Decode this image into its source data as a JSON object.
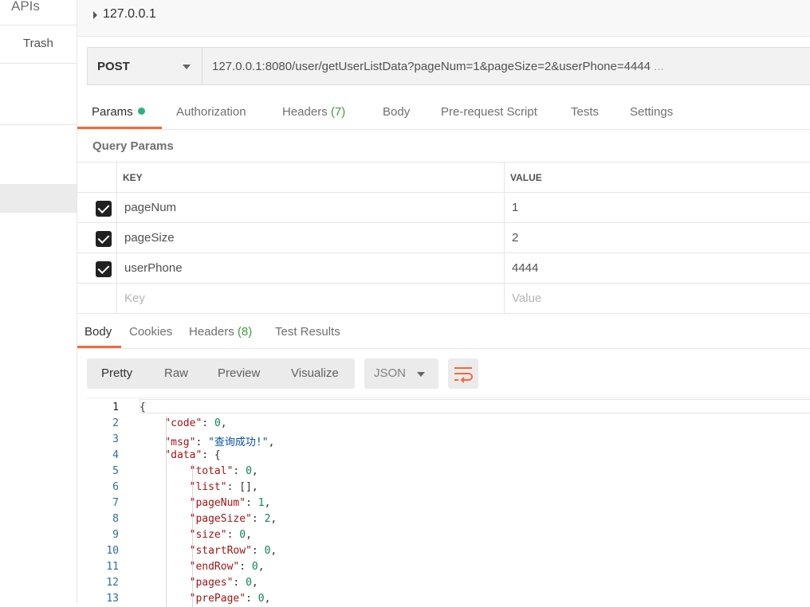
{
  "sidebar": {
    "apis_label": "APIs",
    "trash_label": "Trash"
  },
  "request": {
    "name": "127.0.0.1",
    "method": "POST",
    "url": "127.0.0.1:8080/user/getUserListData?pageNum=1&pageSize=2&userPhone=4444",
    "url_overflow": "..."
  },
  "request_tabs": [
    {
      "label": "Params",
      "count": ""
    },
    {
      "label": "Authorization",
      "count": ""
    },
    {
      "label": "Headers",
      "count": "(7)"
    },
    {
      "label": "Body",
      "count": ""
    },
    {
      "label": "Pre-request Script",
      "count": ""
    },
    {
      "label": "Tests",
      "count": ""
    },
    {
      "label": "Settings",
      "count": ""
    }
  ],
  "query_params": {
    "title": "Query Params",
    "key_header": "KEY",
    "value_header": "VALUE",
    "rows": [
      {
        "key": "pageNum",
        "value": "1",
        "checked": true
      },
      {
        "key": "pageSize",
        "value": "2",
        "checked": true
      },
      {
        "key": "userPhone",
        "value": "4444",
        "checked": true
      }
    ],
    "key_placeholder": "Key",
    "value_placeholder": "Value"
  },
  "response_tabs": [
    {
      "label": "Body",
      "count": ""
    },
    {
      "label": "Cookies",
      "count": ""
    },
    {
      "label": "Headers",
      "count": "(8)"
    },
    {
      "label": "Test Results",
      "count": ""
    }
  ],
  "view_modes": [
    "Pretty",
    "Raw",
    "Preview",
    "Visualize"
  ],
  "format": "JSON",
  "colors": {
    "accent": "#f26b3a",
    "status_green": "#26b47f",
    "count_green": "#3f9b3f"
  },
  "code_lines": [
    {
      "num": "1",
      "parts": [
        [
          "p",
          "{"
        ]
      ]
    },
    {
      "num": "2",
      "parts": [
        [
          "p",
          "    "
        ],
        [
          "k",
          "\"code\""
        ],
        [
          "p",
          ": "
        ],
        [
          "n",
          "0"
        ],
        [
          "p",
          ","
        ]
      ]
    },
    {
      "num": "3",
      "parts": [
        [
          "p",
          "    "
        ],
        [
          "k",
          "\"msg\""
        ],
        [
          "p",
          ": "
        ],
        [
          "s",
          "\"查询成功!\""
        ],
        [
          "p",
          ","
        ]
      ]
    },
    {
      "num": "4",
      "parts": [
        [
          "p",
          "    "
        ],
        [
          "k",
          "\"data\""
        ],
        [
          "p",
          ": {"
        ]
      ]
    },
    {
      "num": "5",
      "parts": [
        [
          "p",
          "        "
        ],
        [
          "k",
          "\"total\""
        ],
        [
          "p",
          ": "
        ],
        [
          "n",
          "0"
        ],
        [
          "p",
          ","
        ]
      ]
    },
    {
      "num": "6",
      "parts": [
        [
          "p",
          "        "
        ],
        [
          "k",
          "\"list\""
        ],
        [
          "p",
          ": [],"
        ]
      ]
    },
    {
      "num": "7",
      "parts": [
        [
          "p",
          "        "
        ],
        [
          "k",
          "\"pageNum\""
        ],
        [
          "p",
          ": "
        ],
        [
          "n",
          "1"
        ],
        [
          "p",
          ","
        ]
      ]
    },
    {
      "num": "8",
      "parts": [
        [
          "p",
          "        "
        ],
        [
          "k",
          "\"pageSize\""
        ],
        [
          "p",
          ": "
        ],
        [
          "n",
          "2"
        ],
        [
          "p",
          ","
        ]
      ]
    },
    {
      "num": "9",
      "parts": [
        [
          "p",
          "        "
        ],
        [
          "k",
          "\"size\""
        ],
        [
          "p",
          ": "
        ],
        [
          "n",
          "0"
        ],
        [
          "p",
          ","
        ]
      ]
    },
    {
      "num": "10",
      "parts": [
        [
          "p",
          "        "
        ],
        [
          "k",
          "\"startRow\""
        ],
        [
          "p",
          ": "
        ],
        [
          "n",
          "0"
        ],
        [
          "p",
          ","
        ]
      ]
    },
    {
      "num": "11",
      "parts": [
        [
          "p",
          "        "
        ],
        [
          "k",
          "\"endRow\""
        ],
        [
          "p",
          ": "
        ],
        [
          "n",
          "0"
        ],
        [
          "p",
          ","
        ]
      ]
    },
    {
      "num": "12",
      "parts": [
        [
          "p",
          "        "
        ],
        [
          "k",
          "\"pages\""
        ],
        [
          "p",
          ": "
        ],
        [
          "n",
          "0"
        ],
        [
          "p",
          ","
        ]
      ]
    },
    {
      "num": "13",
      "parts": [
        [
          "p",
          "        "
        ],
        [
          "k",
          "\"prePage\""
        ],
        [
          "p",
          ": "
        ],
        [
          "n",
          "0"
        ],
        [
          "p",
          ","
        ]
      ]
    }
  ]
}
